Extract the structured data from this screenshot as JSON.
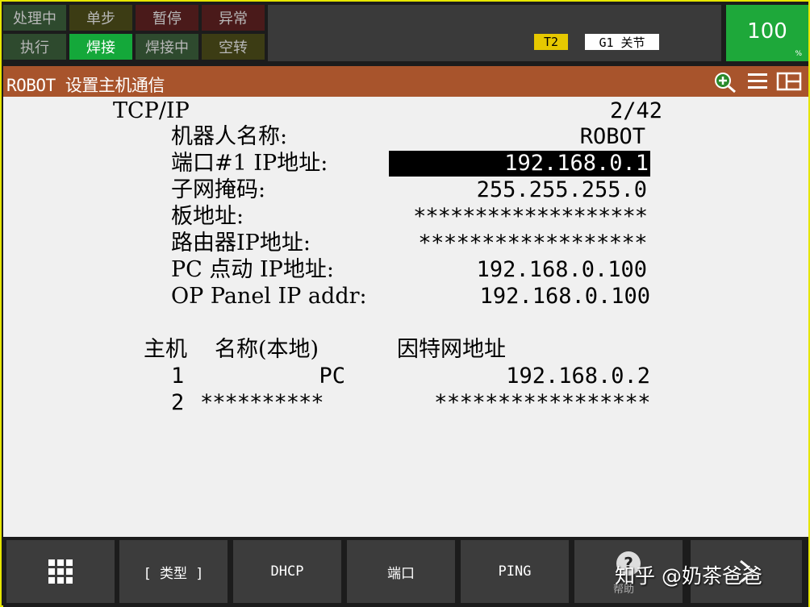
{
  "status": {
    "row1": [
      "处理中",
      "单步",
      "暂停",
      "异常"
    ],
    "row2": [
      "执行",
      "焊接",
      "焊接中",
      "空转"
    ]
  },
  "indicators": {
    "mode": "T2",
    "group_coord": "G1 关节",
    "override": "100",
    "override_unit": "%"
  },
  "header": {
    "title": "ROBOT 设置主机通信"
  },
  "tcpip": {
    "heading": "TCP/IP",
    "page": "2/42",
    "rows": [
      {
        "label": "机器人名称:",
        "value": "ROBOT"
      },
      {
        "label": "端口#1 IP地址:",
        "value": "192.168.0.1"
      },
      {
        "label": "子网掩码:",
        "value": "255.255.255.0"
      },
      {
        "label": "板地址:",
        "value": "*******************"
      },
      {
        "label": "路由器IP地址:",
        "value": "******************"
      },
      {
        "label": "PC 点动 IP地址:",
        "value": "192.168.0.100"
      },
      {
        "label": "OP Panel IP addr:",
        "value": "192.168.0.100"
      }
    ]
  },
  "hosts": {
    "col_host": "主机",
    "col_name": "名称(本地)",
    "col_ip": "因特网地址",
    "rows": [
      {
        "num": "1",
        "name": "PC",
        "ip": "192.168.0.2"
      },
      {
        "num": "2",
        "name": "**********",
        "ip": "*****************"
      }
    ]
  },
  "function_keys": {
    "f1": "[ 类型 ]",
    "f2": "DHCP",
    "f3": "端口",
    "f4": "PING",
    "help": "帮助"
  },
  "watermark": "知乎 @奶茶爸爸"
}
